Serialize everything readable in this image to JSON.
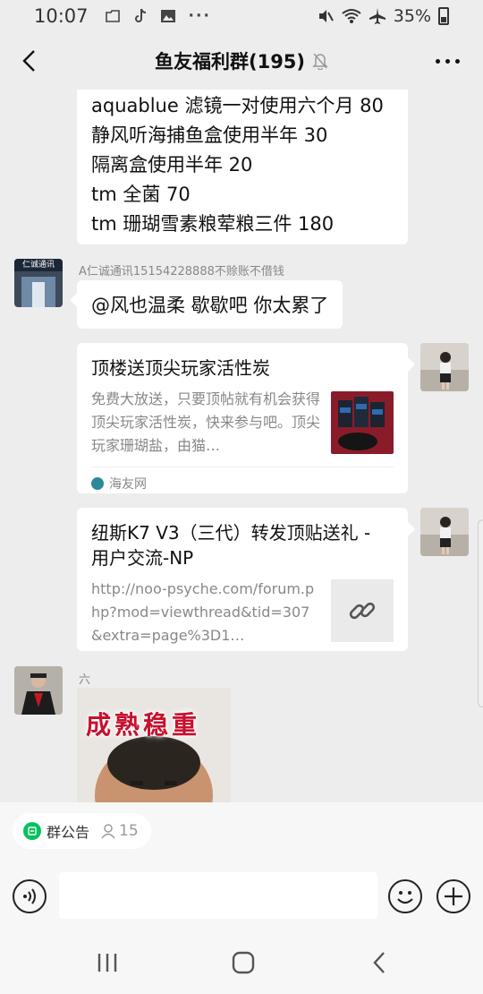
{
  "status": {
    "time": "10:07",
    "battery": "35%"
  },
  "header": {
    "title": "鱼友福利群(195)"
  },
  "messages": {
    "list_lines": [
      "aquablue 滤镜一对使用六个月 80",
      "静风听海捕鱼盒使用半年 30",
      "隔离盒使用半年 20",
      "tm 全菌 70",
      "tm 珊瑚雪素粮荤粮三件 180"
    ],
    "msg2": {
      "sender": "A仁诚通讯15154228888不赊账不借钱",
      "text": "@风也温柔  歇歇吧 你太累了",
      "avatar_label": "仁诚通讯"
    },
    "card1": {
      "title": "顶楼送顶尖玩家活性炭",
      "desc": "免费大放送，只要顶帖就有机会获得顶尖玩家活性炭，快来参与吧。顶尖玩家珊瑚盐，由猫…",
      "source": "海友网"
    },
    "card2": {
      "title": "纽斯K7 V3（三代）转发顶贴送礼 - 用户交流-NP",
      "desc": "http://noo-psyche.com/forum.php?mod=viewthread&tid=307&extra=page%3D1…"
    },
    "msg5": {
      "sender": "六",
      "photo_caption": "成熟稳重"
    }
  },
  "bottom": {
    "notice_label": "群公告",
    "notice_count": "15",
    "input_placeholder": ""
  },
  "colors": {
    "background": "#ededed",
    "bubble": "#ffffff",
    "accent_green": "#07c160",
    "caption_red": "#c8102e"
  }
}
